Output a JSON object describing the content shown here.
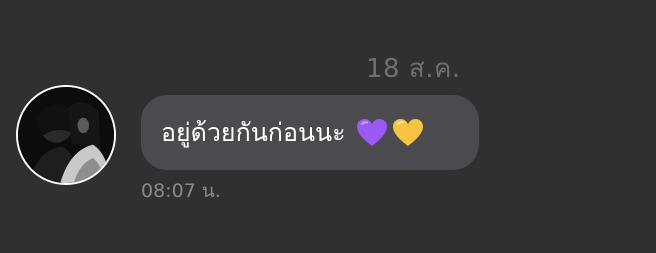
{
  "conversation": {
    "date_separator": "18 ส.ค.",
    "messages": [
      {
        "text": "อยู่ด้วยกันก่อนนะ",
        "emoji": [
          "purple-heart",
          "yellow-heart"
        ],
        "time": "08:07 น."
      }
    ]
  },
  "colors": {
    "background": "#303030",
    "bubble": "#4a4a4f",
    "purple_heart": "#9b59f5",
    "yellow_heart": "#f6c443"
  }
}
